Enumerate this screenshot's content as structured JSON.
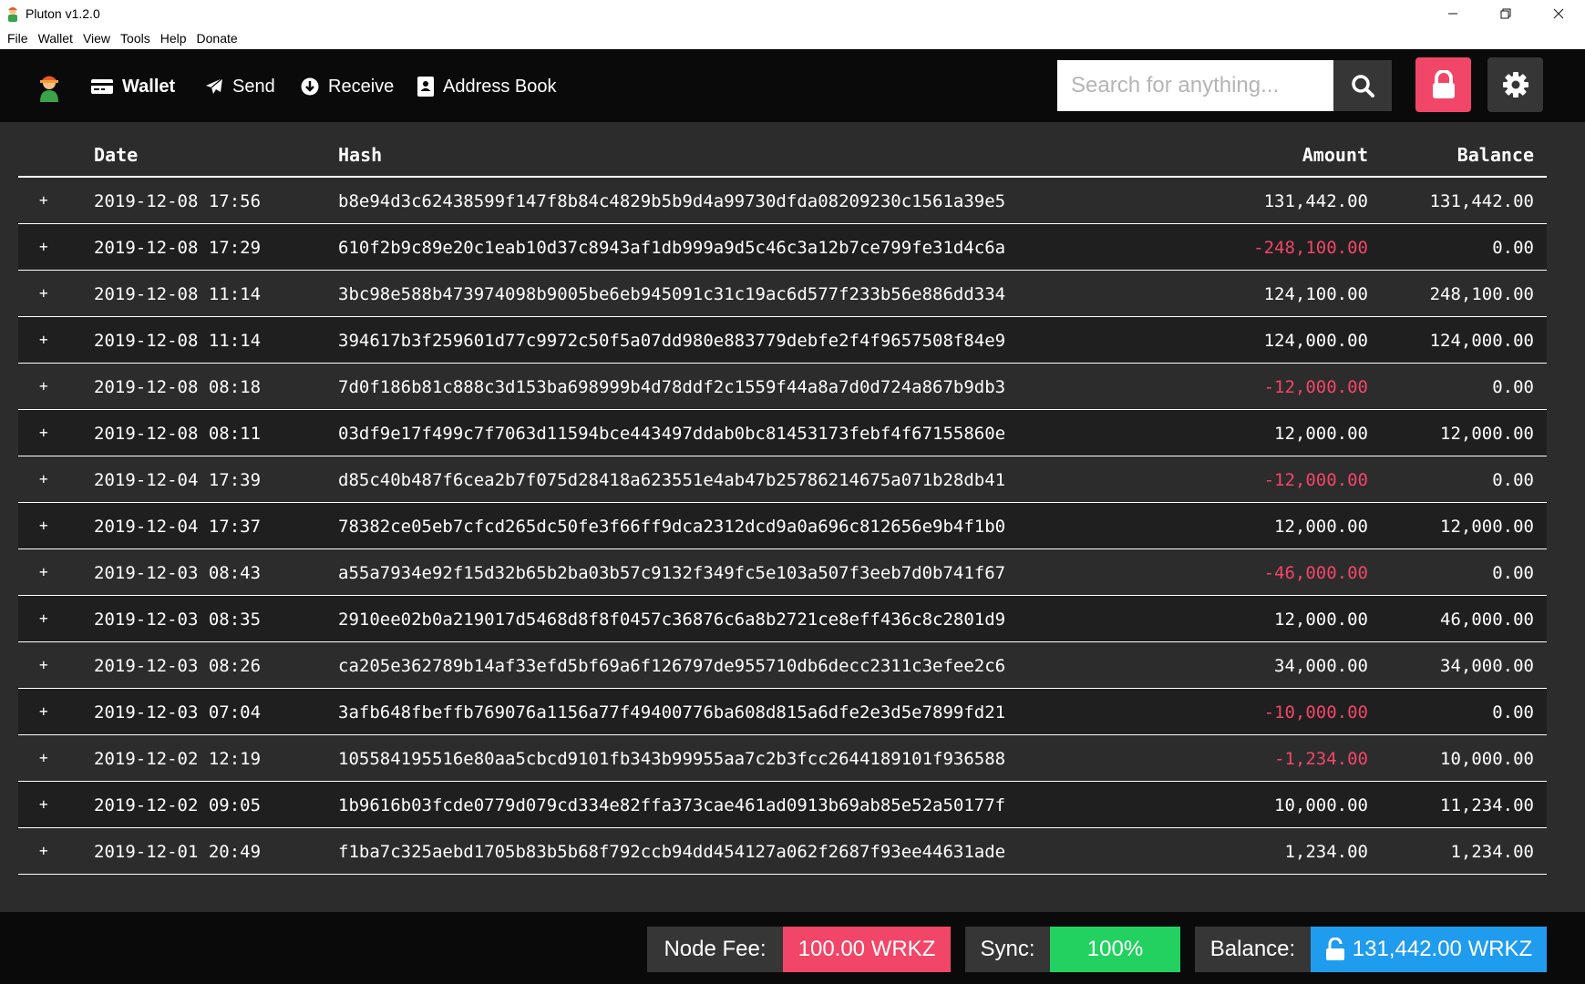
{
  "window": {
    "title": "Pluton v1.2.0",
    "controls": [
      "minimize",
      "restore",
      "close"
    ]
  },
  "menu": [
    "File",
    "Wallet",
    "View",
    "Tools",
    "Help",
    "Donate"
  ],
  "nav": {
    "items": [
      {
        "label": "Wallet",
        "icon": "wallet-icon",
        "active": true
      },
      {
        "label": "Send",
        "icon": "paper-plane-icon",
        "active": false
      },
      {
        "label": "Receive",
        "icon": "arrow-circle-down-icon",
        "active": false
      },
      {
        "label": "Address Book",
        "icon": "address-book-icon",
        "active": false
      }
    ],
    "search_placeholder": "Search for anything..."
  },
  "colors": {
    "danger": "#f14668",
    "success": "#23d160",
    "info": "#209cee",
    "dark": "#363636"
  },
  "table": {
    "headers": {
      "date": "Date",
      "hash": "Hash",
      "amount": "Amount",
      "balance": "Balance"
    },
    "rows": [
      {
        "expand": "+",
        "date": "2019-12-08 17:56",
        "hash": "b8e94d3c62438599f147f8b84c4829b5b9d4a99730dfda08209230c1561a39e5",
        "amount": "131,442.00",
        "balance": "131,442.00",
        "negative": false
      },
      {
        "expand": "+",
        "date": "2019-12-08 17:29",
        "hash": "610f2b9c89e20c1eab10d37c8943af1db999a9d5c46c3a12b7ce799fe31d4c6a",
        "amount": "-248,100.00",
        "balance": "0.00",
        "negative": true
      },
      {
        "expand": "+",
        "date": "2019-12-08 11:14",
        "hash": "3bc98e588b473974098b9005be6eb945091c31c19ac6d577f233b56e886dd334",
        "amount": "124,100.00",
        "balance": "248,100.00",
        "negative": false
      },
      {
        "expand": "+",
        "date": "2019-12-08 11:14",
        "hash": "394617b3f259601d77c9972c50f5a07dd980e883779debfe2f4f9657508f84e9",
        "amount": "124,000.00",
        "balance": "124,000.00",
        "negative": false
      },
      {
        "expand": "+",
        "date": "2019-12-08 08:18",
        "hash": "7d0f186b81c888c3d153ba698999b4d78ddf2c1559f44a8a7d0d724a867b9db3",
        "amount": "-12,000.00",
        "balance": "0.00",
        "negative": true
      },
      {
        "expand": "+",
        "date": "2019-12-08 08:11",
        "hash": "03df9e17f499c7f7063d11594bce443497ddab0bc81453173febf4f67155860e",
        "amount": "12,000.00",
        "balance": "12,000.00",
        "negative": false
      },
      {
        "expand": "+",
        "date": "2019-12-04 17:39",
        "hash": "d85c40b487f6cea2b7f075d28418a623551e4ab47b25786214675a071b28db41",
        "amount": "-12,000.00",
        "balance": "0.00",
        "negative": true
      },
      {
        "expand": "+",
        "date": "2019-12-04 17:37",
        "hash": "78382ce05eb7cfcd265dc50fe3f66ff9dca2312dcd9a0a696c812656e9b4f1b0",
        "amount": "12,000.00",
        "balance": "12,000.00",
        "negative": false
      },
      {
        "expand": "+",
        "date": "2019-12-03 08:43",
        "hash": "a55a7934e92f15d32b65b2ba03b57c9132f349fc5e103a507f3eeb7d0b741f67",
        "amount": "-46,000.00",
        "balance": "0.00",
        "negative": true
      },
      {
        "expand": "+",
        "date": "2019-12-03 08:35",
        "hash": "2910ee02b0a219017d5468d8f8f0457c36876c6a8b2721ce8eff436c8c2801d9",
        "amount": "12,000.00",
        "balance": "46,000.00",
        "negative": false
      },
      {
        "expand": "+",
        "date": "2019-12-03 08:26",
        "hash": "ca205e362789b14af33efd5bf69a6f126797de955710db6decc2311c3efee2c6",
        "amount": "34,000.00",
        "balance": "34,000.00",
        "negative": false
      },
      {
        "expand": "+",
        "date": "2019-12-03 07:04",
        "hash": "3afb648fbeffb769076a1156a77f49400776ba608d815a6dfe2e3d5e7899fd21",
        "amount": "-10,000.00",
        "balance": "0.00",
        "negative": true
      },
      {
        "expand": "+",
        "date": "2019-12-02 12:19",
        "hash": "105584195516e80aa5cbcd9101fb343b99955aa7c2b3fcc2644189101f936588",
        "amount": "-1,234.00",
        "balance": "10,000.00",
        "negative": true
      },
      {
        "expand": "+",
        "date": "2019-12-02 09:05",
        "hash": "1b9616b03fcde0779d079cd334e82ffa373cae461ad0913b69ab85e52a50177f",
        "amount": "10,000.00",
        "balance": "11,234.00",
        "negative": false
      },
      {
        "expand": "+",
        "date": "2019-12-01 20:49",
        "hash": "f1ba7c325aebd1705b83b5b68f792ccb94dd454127a062f2687f93ee44631ade",
        "amount": "1,234.00",
        "balance": "1,234.00",
        "negative": false
      }
    ]
  },
  "footer": {
    "node_fee_label": "Node Fee:",
    "node_fee_value": "100.00 WRKZ",
    "sync_label": "Sync:",
    "sync_value": "100%",
    "balance_label": "Balance:",
    "balance_value": "131,442.00 WRKZ"
  }
}
